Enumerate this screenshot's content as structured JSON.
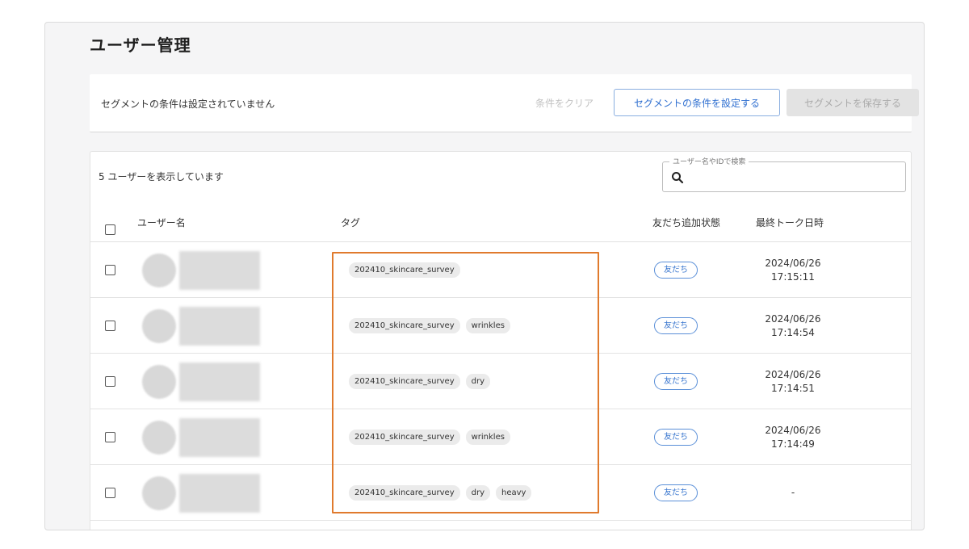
{
  "page": {
    "title": "ユーザー管理"
  },
  "segment": {
    "status_text": "セグメントの条件は設定されていません",
    "clear_label": "条件をクリア",
    "set_label": "セグメントの条件を設定する",
    "save_label": "セグメントを保存する"
  },
  "users": {
    "count_text": "5 ユーザーを表示しています",
    "search_legend": "ユーザー名やIDで検索",
    "search_value": "",
    "columns": {
      "user": "ユーザー名",
      "tag": "タグ",
      "status": "友だち追加状態",
      "last_talk": "最終トーク日時"
    },
    "rows": [
      {
        "tags": [
          "202410_skincare_survey"
        ],
        "status": "友だち",
        "date": "2024/06/26",
        "time": "17:15:11"
      },
      {
        "tags": [
          "202410_skincare_survey",
          "wrinkles"
        ],
        "status": "友だち",
        "date": "2024/06/26",
        "time": "17:14:54"
      },
      {
        "tags": [
          "202410_skincare_survey",
          "dry"
        ],
        "status": "友だち",
        "date": "2024/06/26",
        "time": "17:14:51"
      },
      {
        "tags": [
          "202410_skincare_survey",
          "wrinkles"
        ],
        "status": "友だち",
        "date": "2024/06/26",
        "time": "17:14:49"
      },
      {
        "tags": [
          "202410_skincare_survey",
          "dry",
          "heavy"
        ],
        "status": "友だち",
        "date": "-",
        "time": ""
      }
    ]
  },
  "colors": {
    "accent": "#2f6fd0",
    "highlight": "#e07a2d"
  }
}
